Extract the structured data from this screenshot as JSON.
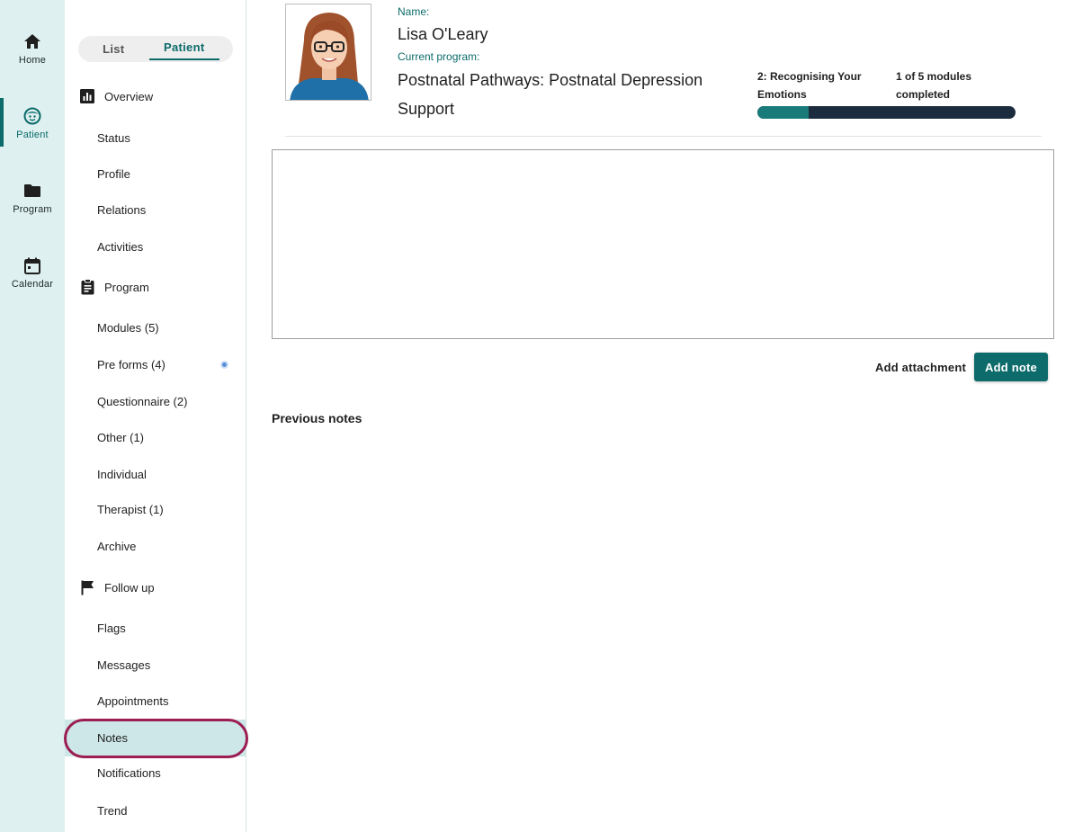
{
  "rail": {
    "items": [
      {
        "label": "Home",
        "icon": "home-icon"
      },
      {
        "label": "Patient",
        "icon": "patient-face-icon"
      },
      {
        "label": "Program",
        "icon": "folder-icon"
      },
      {
        "label": "Calendar",
        "icon": "calendar-icon"
      }
    ],
    "active": "Patient"
  },
  "nav": {
    "toggle": {
      "list": "List",
      "patient": "Patient",
      "selected": "Patient"
    },
    "sections": [
      {
        "label": "Overview",
        "icon": "bar-chart-icon",
        "items": [
          "Status",
          "Profile",
          "Relations",
          "Activities"
        ]
      },
      {
        "label": "Program",
        "icon": "clipboard-icon",
        "items": [
          "Modules (5)",
          "Pre forms (4)",
          "Questionnaire (2)",
          "Other (1)",
          "Individual",
          "Therapist (1)",
          "Archive"
        ]
      },
      {
        "label": "Follow up",
        "icon": "flag-icon",
        "items": [
          "Flags",
          "Messages",
          "Appointments",
          "Notes",
          "Notifications",
          "Trend"
        ]
      }
    ],
    "selected_item": "Notes"
  },
  "patient": {
    "name_label": "Name:",
    "name": "Lisa O'Leary",
    "program_label": "Current program:",
    "program": "Postnatal Pathways: Postnatal Depression Support",
    "current_module": "2: Recognising Your Emotions",
    "modules_completed_text": "1 of 5 modules completed",
    "progress_fraction": 0.2
  },
  "notes": {
    "text": "",
    "add_attachment": "Add attachment",
    "add_note": "Add note",
    "previous_heading": "Previous notes"
  },
  "colors": {
    "accent": "#0d6b6b",
    "rail_bg": "#dff0f0",
    "selected_row": "#cde6e7",
    "highlight_ring": "#9b1d52",
    "progress_track": "#1c2b3d",
    "progress_fill": "#197a7a"
  }
}
